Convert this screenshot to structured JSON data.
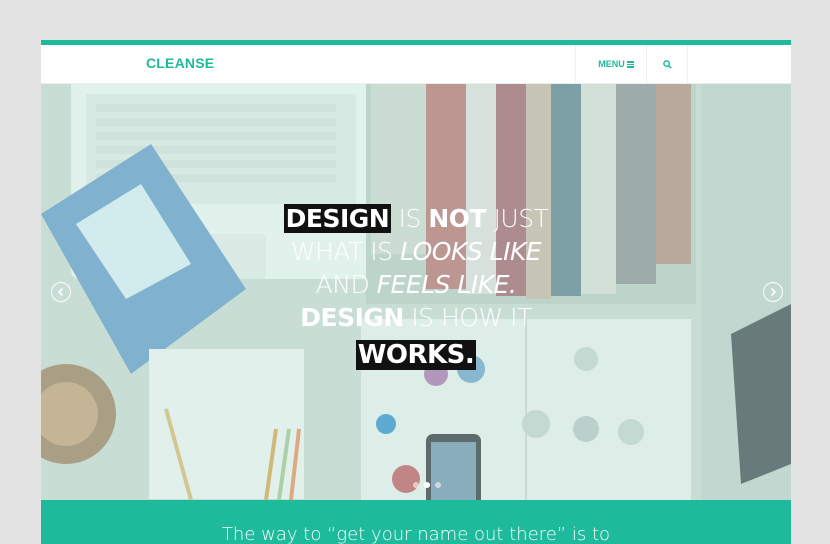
{
  "header": {
    "logo": "CLEANSE",
    "menu_label": "MENU",
    "search_icon": "search-icon"
  },
  "hero": {
    "line1": {
      "a": "DESIGN",
      "b": " IS ",
      "c": "NOT",
      "d": " JUST"
    },
    "line2": {
      "a": "WHAT IS ",
      "b": "LOOKS LIKE"
    },
    "line3": {
      "a": "AND ",
      "b": "FEELS LIKE."
    },
    "line4": {
      "a": "DESIGN",
      "b": " IS HOW IT"
    },
    "line5": {
      "a": "WORKS."
    },
    "prev_icon": "chevron-left-icon",
    "next_icon": "chevron-right-icon",
    "slides": 3,
    "active_slide": 2
  },
  "band": {
    "text": "The way to “get your name out there” is to"
  },
  "colors": {
    "accent": "#1dbb9b",
    "highlight": "#111111"
  }
}
